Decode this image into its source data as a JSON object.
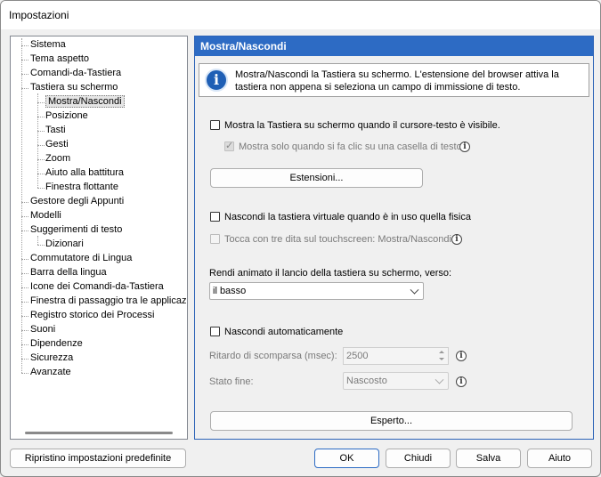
{
  "window": {
    "title": "Impostazioni"
  },
  "tree": {
    "items": [
      {
        "label": "Sistema",
        "level": 0
      },
      {
        "label": "Tema aspetto",
        "level": 0
      },
      {
        "label": "Comandi-da-Tastiera",
        "level": 0
      },
      {
        "label": "Tastiera su schermo",
        "level": 0
      },
      {
        "label": "Mostra/Nascondi",
        "level": 1,
        "selected": true
      },
      {
        "label": "Posizione",
        "level": 1
      },
      {
        "label": "Tasti",
        "level": 1
      },
      {
        "label": "Gesti",
        "level": 1
      },
      {
        "label": "Zoom",
        "level": 1
      },
      {
        "label": "Aiuto alla battitura",
        "level": 1
      },
      {
        "label": "Finestra flottante",
        "level": 1
      },
      {
        "label": "Gestore degli Appunti",
        "level": 0
      },
      {
        "label": "Modelli",
        "level": 0
      },
      {
        "label": "Suggerimenti di testo",
        "level": 0
      },
      {
        "label": "Dizionari",
        "level": 1
      },
      {
        "label": "Commutatore di Lingua",
        "level": 0
      },
      {
        "label": "Barra della lingua",
        "level": 0
      },
      {
        "label": "Icone dei Comandi-da-Tastiera",
        "level": 0
      },
      {
        "label": "Finestra di passaggio tra le applicazioni",
        "level": 0
      },
      {
        "label": "Registro storico dei Processi",
        "level": 0
      },
      {
        "label": "Suoni",
        "level": 0
      },
      {
        "label": "Dipendenze",
        "level": 0
      },
      {
        "label": "Sicurezza",
        "level": 0
      },
      {
        "label": "Avanzate",
        "level": 0
      }
    ]
  },
  "panel": {
    "header": "Mostra/Nascondi",
    "info": "Mostra/Nascondi la Tastiera su schermo. L'estensione del browser attiva la tastiera non appena si seleziona un campo di immissione di testo.",
    "show_on_cursor": {
      "label": "Mostra la Tastiera su schermo quando il cursore-testo è visibile.",
      "checked": false
    },
    "show_on_click": {
      "label": "Mostra solo quando si fa clic su una casella di testo",
      "checked": true,
      "enabled": false
    },
    "extensions_button": "Estensioni...",
    "hide_when_physical": {
      "label": "Nascondi la tastiera virtuale quando è in uso quella fisica",
      "checked": false
    },
    "three_finger": {
      "label": "Tocca con tre dita sul touchscreen: Mostra/Nascondi",
      "checked": false,
      "enabled": false
    },
    "animate_label": "Rendi animato il lancio della tastiera su schermo, verso:",
    "animate_value": "il basso",
    "auto_hide": {
      "label": "Nascondi automaticamente",
      "checked": false
    },
    "delay_label": "Ritardo di scomparsa (msec):",
    "delay_value": "2500",
    "end_state_label": "Stato fine:",
    "end_state_value": "Nascosto",
    "expert_button": "Esperto..."
  },
  "footer": {
    "reset": "Ripristino impostazioni predefinite",
    "ok": "OK",
    "close": "Chiudi",
    "save": "Salva",
    "help": "Aiuto"
  },
  "colors": {
    "accent": "#2d6bc4",
    "info_icon": "#1f5fb5"
  }
}
